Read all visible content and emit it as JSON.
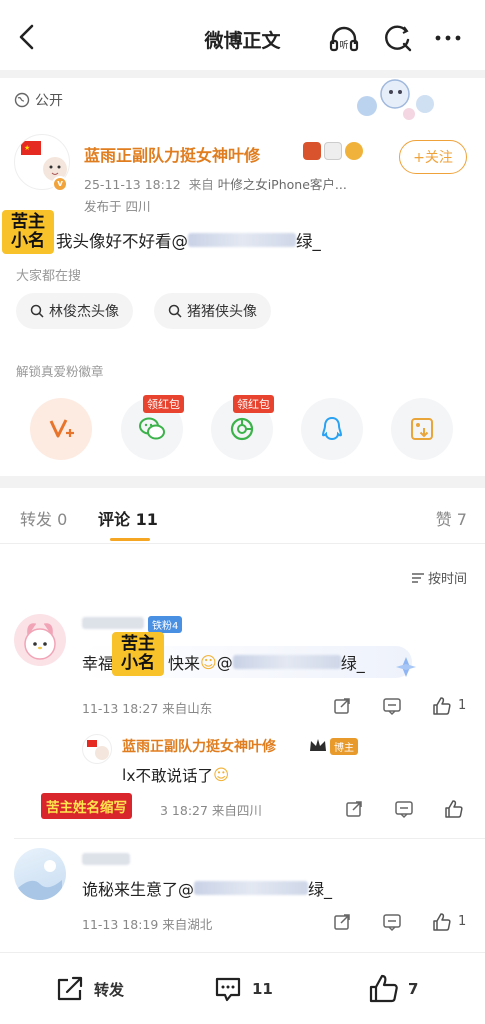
{
  "header": {
    "title": "微博正文"
  },
  "post": {
    "visibility": "公开",
    "author": "蓝雨正副队力挺女神叶修",
    "follow_label": "+关注",
    "date": "25-11-13 18:12",
    "source_prefix": "来自",
    "source": "叶修之女iPhone客户...",
    "published_in": "发布于 四川",
    "text_prefix": "我头像好不好看@",
    "text_suffix": "绿_",
    "verified_mark": "v"
  },
  "overlays": {
    "sticker_label": "苦主小名",
    "sticker_line1": "苦主",
    "sticker_line2": "小名",
    "red_tag": "苦主姓名缩写"
  },
  "search": {
    "heading": "大家都在搜",
    "chips": [
      "林俊杰头像",
      "猪猪侠头像"
    ]
  },
  "unlock": {
    "heading": "解锁真爱粉徽章",
    "hongbao_label": "领红包"
  },
  "tabs": {
    "repost": "转发 0",
    "comments": "评论 11",
    "likes": "赞 7"
  },
  "sort_label": "按时间",
  "comments": [
    {
      "fan_badge": "铁粉4",
      "text_prefix": "幸福",
      "text_mid": "快来",
      "text_at": "@",
      "text_suffix": "绿_",
      "meta": "11-13 18:27 来自山东",
      "likes": "1"
    },
    {
      "text_prefix": "诡秘来生意了@",
      "text_suffix": "绿_",
      "meta": "11-13 18:19 来自湖北",
      "likes": "1"
    }
  ],
  "reply": {
    "author": "蓝雨正副队力挺女神叶修",
    "badge": "博主",
    "text_prefix": "l",
    "text_body": "x不敢说话了",
    "meta": "3 18:27 来自四川"
  },
  "bottom": {
    "repost": "转发",
    "comments": "11",
    "likes": "7"
  },
  "colors": {
    "accent": "#f0a23a",
    "name": "#e07d1f",
    "sticker": "#f8c22b",
    "tag": "#d8262c"
  }
}
